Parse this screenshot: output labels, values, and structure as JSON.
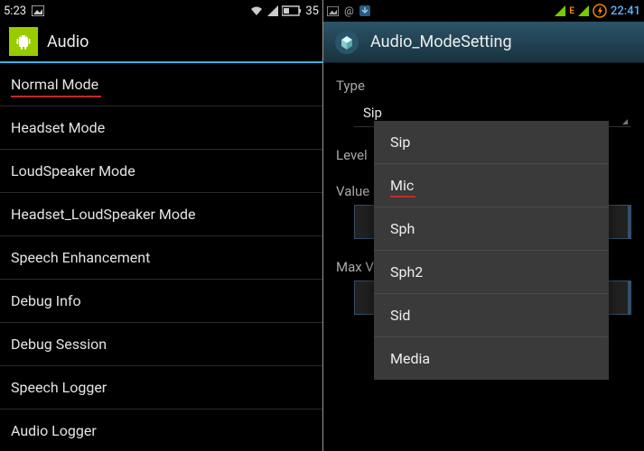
{
  "left": {
    "status": {
      "time": "5:23",
      "battery": "35"
    },
    "title": "Audio",
    "items": [
      {
        "label": "Normal Mode",
        "highlight": true
      },
      {
        "label": "Headset Mode"
      },
      {
        "label": "LoudSpeaker Mode"
      },
      {
        "label": "Headset_LoudSpeaker Mode"
      },
      {
        "label": "Speech Enhancement"
      },
      {
        "label": "Debug Info"
      },
      {
        "label": "Debug Session"
      },
      {
        "label": "Speech Logger"
      },
      {
        "label": "Audio Logger"
      }
    ]
  },
  "right": {
    "status": {
      "time": "22:41"
    },
    "title": "Audio_ModeSetting",
    "fields": {
      "type_label": "Type",
      "type_value": "Sip",
      "level_label": "Level",
      "value_label": "Value",
      "max_label": "Max V"
    },
    "dropdown": {
      "options": [
        {
          "label": "Sip"
        },
        {
          "label": "Mic",
          "selected": true
        },
        {
          "label": "Sph"
        },
        {
          "label": "Sph2"
        },
        {
          "label": "Sid"
        },
        {
          "label": "Media"
        }
      ]
    }
  }
}
